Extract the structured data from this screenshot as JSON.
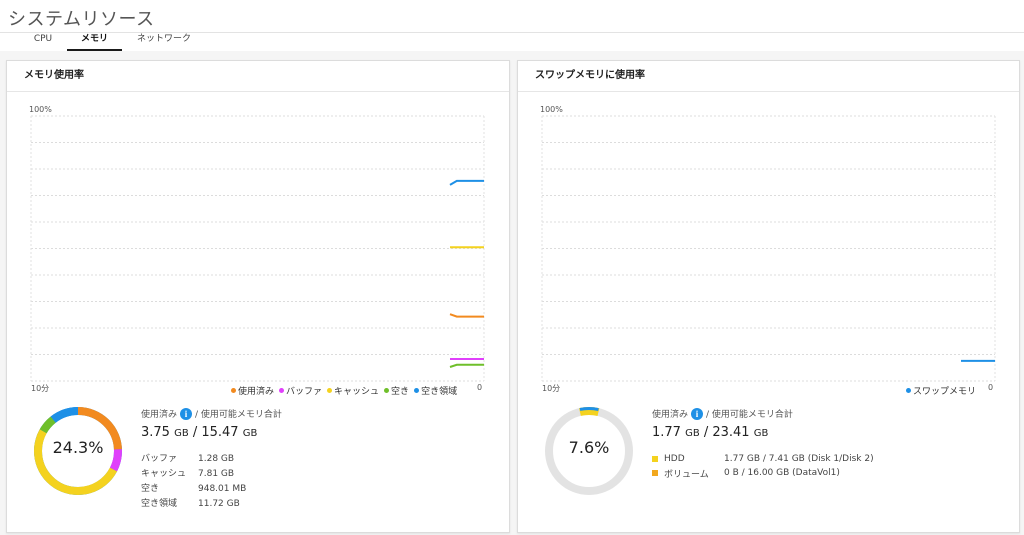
{
  "window": {
    "title": "システムリソース"
  },
  "tabs": [
    {
      "label": "CPU",
      "active": false
    },
    {
      "label": "メモリ",
      "active": true
    },
    {
      "label": "ネットワーク",
      "active": false
    }
  ],
  "memory_panel": {
    "title": "メモリ使用率",
    "y_max_label": "100%",
    "x_start_label": "10分",
    "x_end_label": "0",
    "legend": [
      {
        "label": "使用済み",
        "color": "#f28a1f"
      },
      {
        "label": "バッファ",
        "color": "#e040fb"
      },
      {
        "label": "キャッシュ",
        "color": "#f4d21f"
      },
      {
        "label": "空き",
        "color": "#6fbf2a"
      },
      {
        "label": "空き領域",
        "color": "#1e90e6"
      }
    ],
    "donut_percent": "24.3%",
    "used_label": "使用済み",
    "total_label": "/ 使用可能メモリ合計",
    "used_value": "3.75",
    "used_unit": "GB",
    "total_value": "/ 15.47",
    "total_unit": "GB",
    "details": [
      {
        "label": "バッファ",
        "value": "1.28 GB"
      },
      {
        "label": "キャッシュ",
        "value": "7.81 GB"
      },
      {
        "label": "空き",
        "value": "948.01 MB"
      },
      {
        "label": "空き領域",
        "value": "11.72 GB"
      }
    ]
  },
  "swap_panel": {
    "title": "スワップメモリに使用率",
    "y_max_label": "100%",
    "x_start_label": "10分",
    "x_end_label": "0",
    "legend": [
      {
        "label": "スワップメモリ",
        "color": "#1e90e6"
      }
    ],
    "donut_percent": "7.6%",
    "used_label": "使用済み",
    "total_label": "/ 使用可能メモリ合計",
    "used_value": "1.77",
    "used_unit": "GB",
    "total_value": "/ 23.41",
    "total_unit": "GB",
    "storage": [
      {
        "label": "HDD",
        "value": "1.77 GB / 7.41 GB (Disk 1/Disk 2)",
        "color": "#f4d21f"
      },
      {
        "label": "ボリューム",
        "value": "0 B / 16.00 GB (DataVol1)",
        "color": "#f2a81f"
      }
    ]
  },
  "info_icon_glyph": "i",
  "chart_data": [
    {
      "type": "line",
      "title": "メモリ使用率",
      "y_unit": "%",
      "ylim": [
        0,
        100
      ],
      "x_range_minutes": [
        10,
        0
      ],
      "series": [
        {
          "name": "空き領域",
          "color": "#1e90e6",
          "values": [
            74,
            75.5,
            75.5,
            75.5,
            75.5,
            75.5
          ]
        },
        {
          "name": "キャッシュ",
          "color": "#f4d21f",
          "values": [
            50.5,
            50.5,
            50.5,
            50.5,
            50.5,
            50.5
          ]
        },
        {
          "name": "使用済み",
          "color": "#f28a1f",
          "values": [
            25.2,
            24.3,
            24.3,
            24.3,
            24.3,
            24.3
          ]
        },
        {
          "name": "バッファ",
          "color": "#e040fb",
          "values": [
            8.3,
            8.3,
            8.3,
            8.3,
            8.3,
            8.3
          ]
        },
        {
          "name": "空き",
          "color": "#6fbf2a",
          "values": [
            5.3,
            6.1,
            6.1,
            6.1,
            6.1,
            6.1
          ]
        }
      ],
      "donut": [
        {
          "name": "使用済み",
          "value": 24.3,
          "color": "#f28a1f"
        },
        {
          "name": "バッファ",
          "value": 8.3,
          "color": "#e040fb"
        },
        {
          "name": "キャッシュ",
          "value": 50.5,
          "color": "#f4d21f"
        },
        {
          "name": "空き",
          "value": 6.1,
          "color": "#6fbf2a"
        },
        {
          "name": "空き領域",
          "value": 10.8,
          "color": "#1e90e6"
        }
      ]
    },
    {
      "type": "line",
      "title": "スワップメモリに使用率",
      "y_unit": "%",
      "ylim": [
        0,
        100
      ],
      "x_range_minutes": [
        10,
        0
      ],
      "series": [
        {
          "name": "スワップメモリ",
          "color": "#1e90e6",
          "values": [
            7.6,
            7.6,
            7.6,
            7.6
          ]
        }
      ],
      "donut": [
        {
          "name": "スワップメモリ",
          "value": 7.6,
          "color": "#1e90e6"
        }
      ]
    }
  ]
}
